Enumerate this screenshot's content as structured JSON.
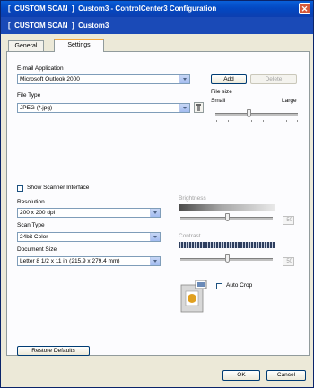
{
  "window": {
    "title": "[  CUSTOM SCAN  ]  Custom3 - ControlCenter3 Configuration"
  },
  "header": {
    "title": "[  CUSTOM SCAN  ]  Custom3"
  },
  "tabs": [
    {
      "label": "General"
    },
    {
      "label": "Settings",
      "active": true
    }
  ],
  "email": {
    "label": "E-mail Application",
    "selected": "Microsoft Outlook 2000",
    "add_label": "Add",
    "delete_label": "Delete"
  },
  "file_type": {
    "label": "File Type",
    "selected": "JPEG (*.jpg)"
  },
  "file_size": {
    "label": "File size",
    "small": "Small",
    "large": "Large",
    "level_fraction": 0.4
  },
  "scanner_interface": {
    "label": "Show Scanner Interface",
    "checked": false
  },
  "resolution": {
    "label": "Resolution",
    "selected": "200 x 200 dpi"
  },
  "scan_type": {
    "label": "Scan Type",
    "selected": "24bit Color"
  },
  "document_size": {
    "label": "Document Size",
    "selected": "Letter 8 1/2 x 11 in (215.9 x 279.4 mm)"
  },
  "brightness": {
    "label": "Brightness",
    "value": "50",
    "enabled": false
  },
  "contrast": {
    "label": "Contrast",
    "value": "50",
    "enabled": false
  },
  "auto_crop": {
    "label": "Auto Crop",
    "checked": false
  },
  "footer": {
    "restore_label": "Restore Defaults",
    "ok_label": "OK",
    "cancel_label": "Cancel"
  },
  "colors": {
    "title_bar": "#0a5fd8",
    "header_bar": "#1a4ab7",
    "window_bg": "#ece9d8",
    "tab_accent": "#f5a93b"
  }
}
